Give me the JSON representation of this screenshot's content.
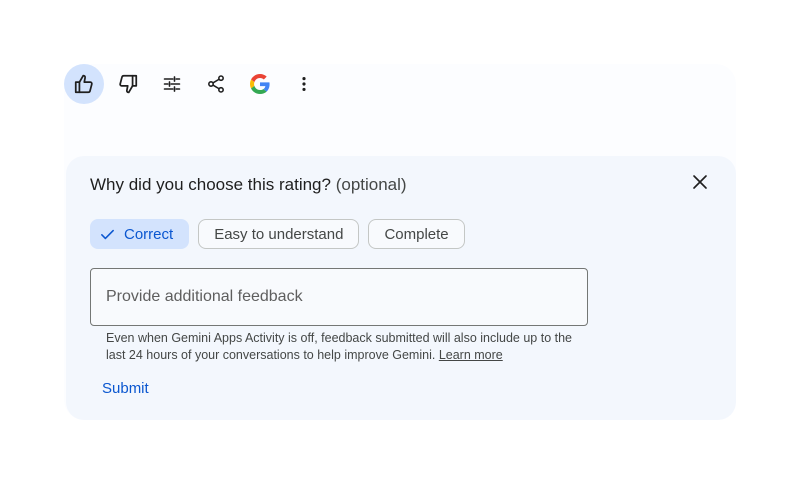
{
  "toolbar": {
    "buttons": [
      {
        "icon": "thumb-up-icon",
        "active": true
      },
      {
        "icon": "thumb-down-icon",
        "active": false
      },
      {
        "icon": "tune-icon",
        "active": false
      },
      {
        "icon": "share-icon",
        "active": false
      },
      {
        "icon": "google-icon",
        "active": false
      },
      {
        "icon": "more-vert-icon",
        "active": false
      }
    ]
  },
  "feedback": {
    "title": "Why did you choose this rating?",
    "title_optional": "(optional)",
    "chips": [
      {
        "label": "Correct",
        "selected": true
      },
      {
        "label": "Easy to understand",
        "selected": false
      },
      {
        "label": "Complete",
        "selected": false
      }
    ],
    "input_placeholder": "Provide additional feedback",
    "input_value": "",
    "disclaimer": "Even when Gemini Apps Activity is off, feedback submitted will also include up to the last 24 hours of your conversations to help improve Gemini.",
    "learn_more": "Learn more",
    "submit_label": "Submit"
  },
  "colors": {
    "accent": "#0b57d0",
    "chip_selected_bg": "#d3e3fd",
    "card_bg": "#f3f7fd"
  }
}
